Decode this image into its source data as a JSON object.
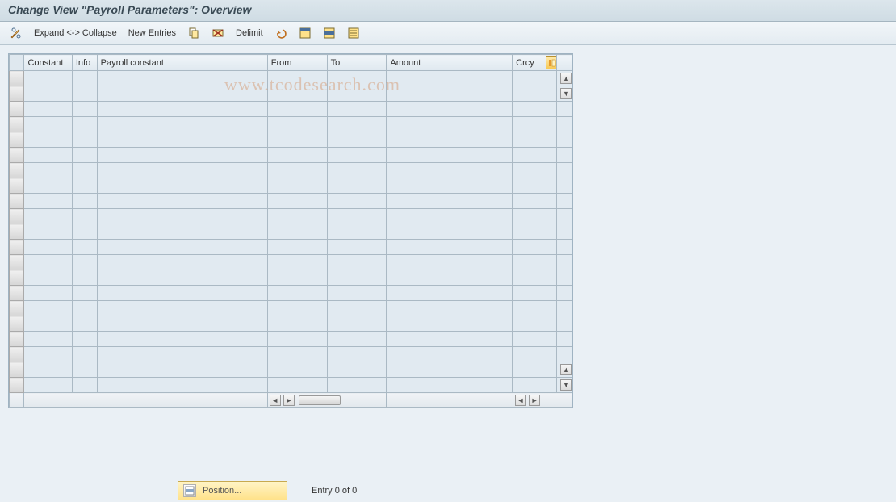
{
  "title": "Change View \"Payroll Parameters\": Overview",
  "toolbar": {
    "expand_collapse": "Expand <-> Collapse",
    "new_entries": "New Entries",
    "delimit": "Delimit"
  },
  "columns": {
    "constant": "Constant",
    "info": "Info",
    "payroll_constant": "Payroll constant",
    "from": "From",
    "to": "To",
    "amount": "Amount",
    "crcy": "Crcy"
  },
  "rows": [
    {},
    {},
    {},
    {},
    {},
    {},
    {},
    {},
    {},
    {},
    {},
    {},
    {},
    {},
    {},
    {},
    {},
    {},
    {},
    {},
    {}
  ],
  "footer": {
    "position": "Position...",
    "entry": "Entry 0 of 0"
  },
  "watermark": "www.tcodesearch.com"
}
